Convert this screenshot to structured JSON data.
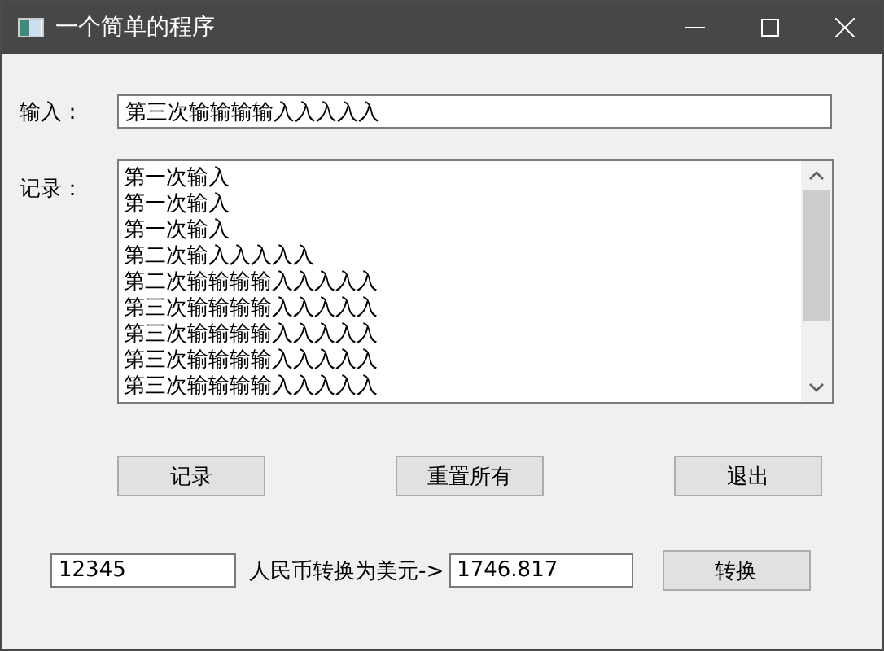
{
  "window": {
    "title": "一个简单的程序"
  },
  "input": {
    "label": "输入：",
    "value": "第三次输输输输入入入入入"
  },
  "record": {
    "label": "记录：",
    "lines": [
      "第一次输入",
      "第一次输入",
      "第一次输入",
      "第二次输入入入入入",
      "第二次输输输输入入入入入",
      "第三次输输输输入入入入入",
      "第三次输输输输入入入入入",
      "第三次输输输输入入入入入",
      "第三次输输输输入入入入入"
    ]
  },
  "buttons": [
    {
      "label": "记录"
    },
    {
      "label": "重置所有"
    },
    {
      "label": "退出"
    }
  ],
  "converter": {
    "amount": "12345",
    "label": "人民币转换为美元->",
    "result": "1746.817",
    "button": "转换"
  }
}
